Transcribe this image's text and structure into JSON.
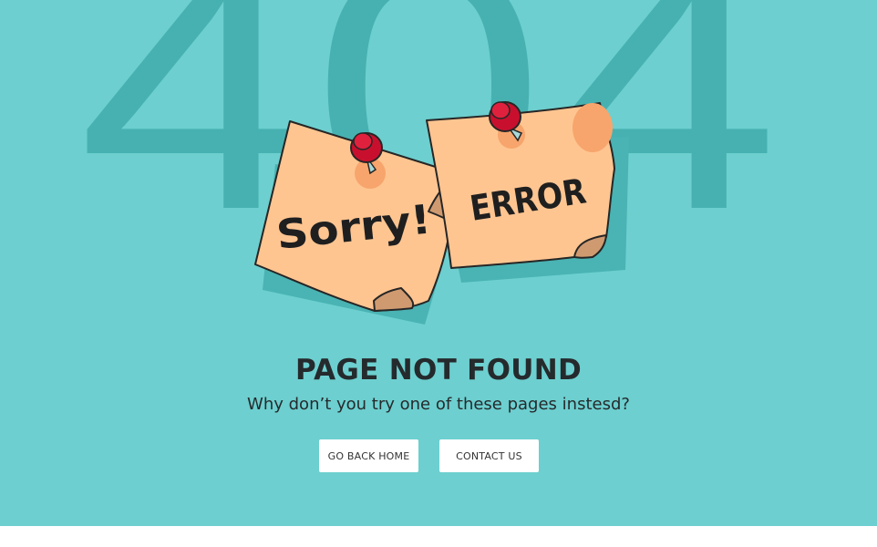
{
  "background": {
    "number_text": "404",
    "color": "#6dcfcf",
    "number_color": "#47b1b1"
  },
  "notes": {
    "left_text": "Sorry!",
    "right_text": "ERROR",
    "paper_color": "#ffc591",
    "pin_color": "#c8102e"
  },
  "main": {
    "title": "PAGE NOT FOUND",
    "subtitle": "Why don’t you try one of these pages instesd?"
  },
  "buttons": {
    "home_label": "GO BACK HOME",
    "contact_label": "CONTACT US"
  }
}
